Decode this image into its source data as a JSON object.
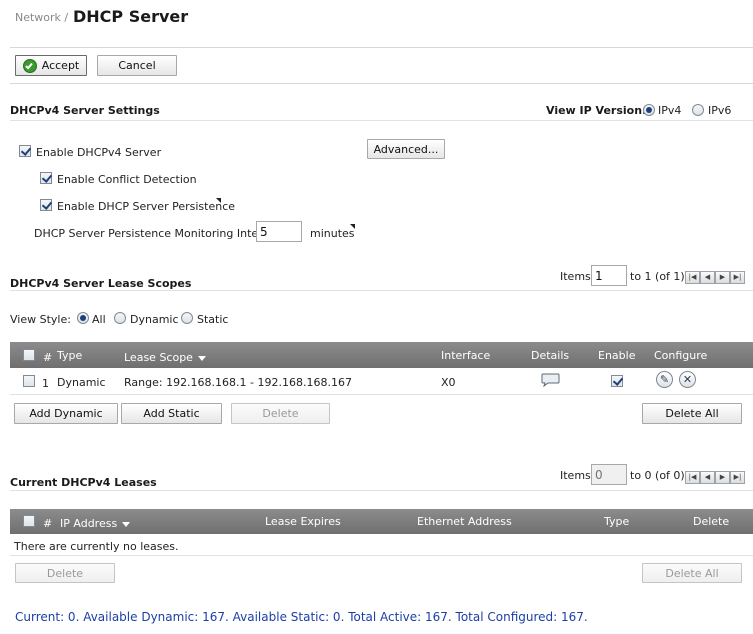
{
  "breadcrumb": {
    "parent": "Network /",
    "title": "DHCP Server"
  },
  "toolbar": {
    "accept_label": "Accept",
    "cancel_label": "Cancel"
  },
  "settings": {
    "section_title": "DHCPv4 Server Settings",
    "view_ip_label": "View IP Version:",
    "ipv4_label": "IPv4",
    "ipv6_label": "IPv6",
    "selected_ip_version": "IPv4",
    "enable_server_label": "Enable DHCPv4 Server",
    "enable_server_checked": true,
    "advanced_label": "Advanced...",
    "conflict_label": "Enable Conflict Detection",
    "conflict_checked": true,
    "persistence_label": "Enable DHCP Server Persistence",
    "persistence_checked": true,
    "interval_label": "DHCP Server Persistence Monitoring Interval:",
    "interval_value": "5",
    "interval_unit": "minutes"
  },
  "scopes": {
    "section_title": "DHCPv4 Server Lease Scopes",
    "items_label": "Items",
    "items_value": "1",
    "range_text": "to 1 (of 1)",
    "view_style_label": "View Style:",
    "view_all": "All",
    "view_dynamic": "Dynamic",
    "view_static": "Static",
    "selected_view": "All",
    "columns": {
      "num": "#",
      "type": "Type",
      "lease_scope": "Lease Scope",
      "interface": "Interface",
      "details": "Details",
      "enable": "Enable",
      "configure": "Configure"
    },
    "rows": [
      {
        "num": "1",
        "type": "Dynamic",
        "lease_scope": "Range: 192.168.168.1 - 192.168.168.167",
        "interface": "X0",
        "enabled": true
      }
    ],
    "add_dynamic_label": "Add Dynamic",
    "add_static_label": "Add Static",
    "delete_label": "Delete",
    "delete_all_label": "Delete All"
  },
  "leases": {
    "section_title": "Current DHCPv4 Leases",
    "items_label": "Items",
    "items_placeholder": "0",
    "range_text": "to 0 (of 0)",
    "columns": {
      "num": "#",
      "ip_address": "IP Address",
      "lease_expires": "Lease Expires",
      "ethernet_address": "Ethernet Address",
      "type": "Type",
      "delete": "Delete"
    },
    "empty_text": "There are currently no leases.",
    "delete_label": "Delete",
    "delete_all_label": "Delete All"
  },
  "status_text": "Current: 0. Available Dynamic: 167. Available Static: 0. Total Active: 167. Total Configured: 167."
}
